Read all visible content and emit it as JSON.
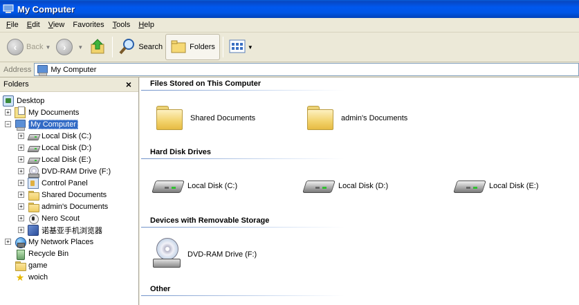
{
  "window": {
    "title": "My Computer"
  },
  "menu": [
    {
      "label": "File",
      "key": "F",
      "rest": "ile"
    },
    {
      "label": "Edit",
      "key": "E",
      "rest": "dit"
    },
    {
      "label": "View",
      "key": "V",
      "rest": "iew"
    },
    {
      "label": "Favorites",
      "key": "",
      "rest": "Favorites"
    },
    {
      "label": "Tools",
      "key": "T",
      "rest": "ools"
    },
    {
      "label": "Help",
      "key": "H",
      "rest": "elp"
    }
  ],
  "toolbar": {
    "back_label": "Back",
    "search_label": "Search",
    "folders_label": "Folders"
  },
  "address": {
    "label": "Address",
    "value": "My Computer"
  },
  "folders_pane": {
    "title": "Folders",
    "close": "×",
    "tree": [
      {
        "label": "Desktop"
      },
      {
        "label": "My Documents"
      },
      {
        "label": "My Computer"
      },
      {
        "label": "Local Disk (C:)"
      },
      {
        "label": "Local Disk (D:)"
      },
      {
        "label": "Local Disk (E:)"
      },
      {
        "label": "DVD-RAM Drive (F:)"
      },
      {
        "label": "Control Panel"
      },
      {
        "label": "Shared Documents"
      },
      {
        "label": "admin's Documents"
      },
      {
        "label": "Nero Scout"
      },
      {
        "label": "诺基亚手机浏览器"
      },
      {
        "label": "My Network Places"
      },
      {
        "label": "Recycle Bin"
      },
      {
        "label": "game"
      },
      {
        "label": "woich"
      }
    ]
  },
  "content": {
    "groups": [
      {
        "title": "Files Stored on This Computer",
        "items": [
          "Shared Documents",
          "admin's Documents"
        ]
      },
      {
        "title": "Hard Disk Drives",
        "items": [
          "Local Disk (C:)",
          "Local Disk (D:)",
          "Local Disk (E:)"
        ]
      },
      {
        "title": "Devices with Removable Storage",
        "items": [
          "DVD-RAM Drive (F:)"
        ]
      },
      {
        "title": "Other",
        "items": []
      }
    ]
  },
  "colors": {
    "titlebar": "#0058ee",
    "selection": "#316ac5",
    "group_line": "#6f91c9"
  }
}
